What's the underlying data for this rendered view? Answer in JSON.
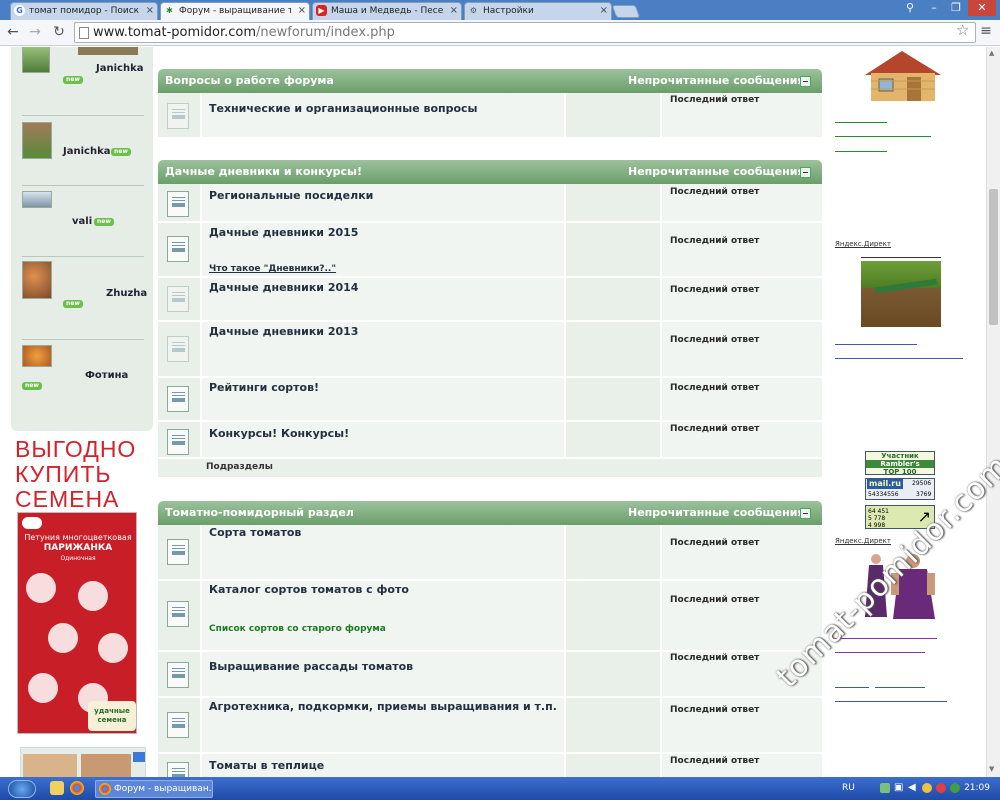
{
  "browser": {
    "tabs": [
      {
        "label": "томат помидор - Поиск в Go",
        "icon": "google-icon",
        "active": false
      },
      {
        "label": "Форум - выращивание тома",
        "icon": "site-favicon-icon",
        "active": true
      },
      {
        "label": "Маша и Медведь - Песе",
        "icon": "youtube-icon",
        "active": false
      },
      {
        "label": "Настройки",
        "icon": "gear-icon",
        "active": false
      }
    ],
    "url_host": "www.tomat-pomidor.com",
    "url_path": "/newforum/index.php"
  },
  "sidebar_users": [
    {
      "name": "Janichka",
      "badge": "new"
    },
    {
      "name": "Janichka",
      "badge": "new"
    },
    {
      "name": "vali",
      "badge": "new"
    },
    {
      "name": "Zhuzha",
      "badge": "new"
    },
    {
      "name": "Фотина",
      "badge": "new"
    }
  ],
  "ad_left": {
    "headline_1": "ВЫГОДНО",
    "headline_2": "КУПИТЬ",
    "headline_3": "СЕМЕНА",
    "pack_title_1": "Петуния многоцветковая",
    "pack_title_2": "ПАРИЖАНКА",
    "pack_subtitle": "Одиночная",
    "pack_brand_1": "удачные",
    "pack_brand_2": "семена"
  },
  "forum": {
    "unread_label": "Непрочитанные сообщения",
    "last_reply_label": "Последний ответ",
    "categories": [
      {
        "title": "Вопросы о работе форума",
        "forums": [
          {
            "name": "Технические и организационные вопросы",
            "sub": ""
          }
        ]
      },
      {
        "title": "Дачные дневники и конкурсы!",
        "forums": [
          {
            "name": "Региональные посиделки",
            "sub": ""
          },
          {
            "name": "Дачные дневники 2015",
            "sub": "Что такое \"Дневники?..\""
          },
          {
            "name": "Дачные дневники 2014",
            "sub": ""
          },
          {
            "name": "Дачные дневники 2013",
            "sub": ""
          },
          {
            "name": "Рейтинги сортов!",
            "sub": ""
          },
          {
            "name": "Конкурсы! Конкурсы!",
            "sub": ""
          }
        ],
        "subsections_label": "Подразделы"
      },
      {
        "title": "Томатно-помидорный раздел",
        "forums": [
          {
            "name": "Сорта томатов",
            "sub": ""
          },
          {
            "name": "Каталог сортов томатов с фото",
            "sub": "Список сортов со старого форума"
          },
          {
            "name": "Выращивание рассады томатов",
            "sub": ""
          },
          {
            "name": "Агротехника, подкормки, приемы выращивания и т.п.",
            "sub": ""
          },
          {
            "name": "Томаты в теплице",
            "sub": ""
          }
        ]
      }
    ]
  },
  "right_col": {
    "yandex_direct_1": "Яндекс.Директ",
    "yandex_direct_2": "Яндекс.Директ",
    "rambler_1": "Участник",
    "rambler_2": "Rambler's",
    "rambler_3": "TOP 100",
    "mailru_label": "mail.ru",
    "mailru_val_1": "29506",
    "mailru_val_2": "54334556",
    "mailru_val_3": "3769",
    "li_val_1": "64 451",
    "li_val_2": "5 778",
    "li_val_3": "4 998"
  },
  "taskbar": {
    "task_label": "Форум - выращиван...",
    "lang": "RU",
    "clock": "21:09"
  },
  "watermark": "tomat-pomidor.com"
}
